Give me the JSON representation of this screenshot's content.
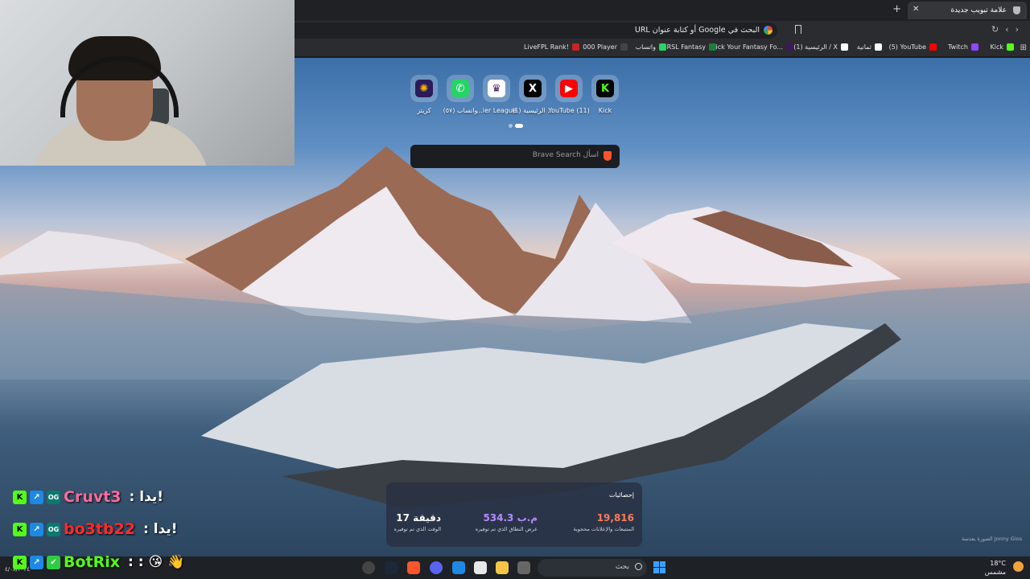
{
  "browser": {
    "tab": {
      "title": "علامة تبويب جديدة"
    },
    "address": {
      "placeholder": "البحث في Google أو كتابة عنوان URL"
    },
    "bookmarks": [
      {
        "label": "Kick",
        "color": "#53fc18"
      },
      {
        "label": "Twitch",
        "color": "#9146ff"
      },
      {
        "label": "(5) YouTube",
        "color": "#ff0000"
      },
      {
        "label": "ثمانية",
        "color": "#ffffff"
      },
      {
        "label": "(1) الرئيسية / X",
        "color": "#ffffff"
      },
      {
        "label": "Pick Your Fantasy Fo...",
        "color": "#3d195b"
      },
      {
        "label": "RSL Fantasy",
        "color": "#1a7f3a"
      },
      {
        "label": "واتساب",
        "color": "#25d366"
      },
      {
        "label": "000 Player",
        "color": "#444444"
      },
      {
        "label": "LiveFPL Rank!",
        "color": "#cc2222"
      }
    ]
  },
  "speed_dial": [
    {
      "label": "Kick",
      "glyph": "K",
      "bg": "#000000",
      "fg": "#53fc18"
    },
    {
      "label": "YouTube (11)",
      "glyph": "▶",
      "bg": "#ff0000",
      "fg": "#ffffff"
    },
    {
      "label": "(1) الرئيسية ...",
      "glyph": "X",
      "bg": "#000000",
      "fg": "#ffffff"
    },
    {
      "label": "...ier League",
      "glyph": "♛",
      "bg": "#ffffff",
      "fg": "#3d195b"
    },
    {
      "label": "واتساب (٥٧)",
      "glyph": "✆",
      "bg": "#25d366",
      "fg": "#ffffff"
    },
    {
      "label": "كريتز",
      "glyph": "✺",
      "bg": "#2a1b5a",
      "fg": "#f5b400"
    }
  ],
  "search": {
    "placeholder": "اسأل Brave Search"
  },
  "stats": {
    "title": "إحصائيات",
    "items": [
      {
        "value": "19,816",
        "label": "المتتبعات والإعلانات محجوبة",
        "color": "#ff7b57"
      },
      {
        "value": "534.3 م.ب",
        "label": "عرض النطاق الذي تم توفيره",
        "color": "#b58cff"
      },
      {
        "value": "17 دقيقة",
        "label": "الوقت الذي تم توفيره",
        "color": "#ffffff"
      }
    ]
  },
  "photo_credit": "الصورة بعدسة Jonny Gios",
  "chat": [
    {
      "name": "Cruvt3",
      "name_color": "#ff6b9a",
      "message": ": يدا!"
    },
    {
      "name": "bo3tb22",
      "name_color": "#ff2b2b",
      "message": ": يدا!"
    },
    {
      "name": "BotRix",
      "name_color": "#53fc18",
      "message": ": : 😘 👋"
    }
  ],
  "taskbar": {
    "search_label": "بحث",
    "weather_temp": "18°C",
    "weather_desc": "مشمس",
    "clock": "٤/٠٨/٢٠٢٤"
  }
}
